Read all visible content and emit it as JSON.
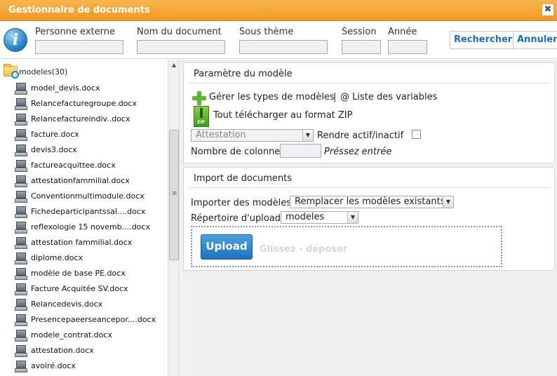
{
  "window": {
    "title": "Gestionnaire de documents",
    "close_glyph": "✖"
  },
  "search": {
    "fields": [
      {
        "label": "Personne externe",
        "value": ""
      },
      {
        "label": "Nom du document",
        "value": ""
      },
      {
        "label": "Sous thème",
        "value": ""
      },
      {
        "label": "Session",
        "value": ""
      },
      {
        "label": "Année",
        "value": ""
      }
    ],
    "search_button": "Rechercher",
    "cancel_button": "Annuler",
    "info_glyph": "i"
  },
  "tree": {
    "folder_label": "modeles(30)",
    "files": [
      "model_devis.docx",
      "Relancefacturegroupe.docx",
      "Relancefactureindiv..docx",
      "facture.docx",
      "devis3.docx",
      "factureacquittee.docx",
      "attestationfammilial.docx",
      "Conventionmultimodule.docx",
      "Fichedeparticipantssal....docx",
      "reflexologie 15 novemb....docx",
      "attestation fammilial.docx",
      "diplome.docx",
      "modèle de base PE.docx",
      "Facture Acquitée SV.docx",
      "Relancedevis.docx",
      "Presencepaeerseancepor....docx",
      "modele_contrat.docx",
      "attestation.docx",
      "avoiré.docx"
    ],
    "scroll_up_glyph": "▲",
    "scroll_grip_glyph": "≡"
  },
  "params": {
    "title": "Paramètre du modèle",
    "manage_types": "Gérer les types de modèles",
    "separator": "|",
    "variables_link": "@ Liste des variables",
    "download_zip": "Tout télécharger au format ZIP",
    "zip_label": "ZIP",
    "type_select": "Attestation",
    "active_toggle": "Rendre actif/inactif",
    "columns_label": "Nombre de colonne",
    "columns_value": "",
    "columns_hint": "Préssez entrée"
  },
  "import": {
    "title": "Import de documents",
    "import_label": "Importer des modèles",
    "import_select": "Remplacer les modèles existants",
    "upload_dir_label": "Répertoire d'upload",
    "upload_dir_select": "modeles",
    "upload_button": "Upload",
    "drop_hint": "Glissez - déposer"
  },
  "icons": {
    "info": "info-icon",
    "folder": "folder-search-icon",
    "file": "computer-document-icon",
    "add": "plus-icon",
    "zip": "zip-icon",
    "dropdown": "chevron-down-icon"
  },
  "colors": {
    "titlebar": "#ee9a26",
    "accent": "#1a6fb5",
    "upload_button": "#1e72b8",
    "plus_green": "#5cb82d"
  }
}
